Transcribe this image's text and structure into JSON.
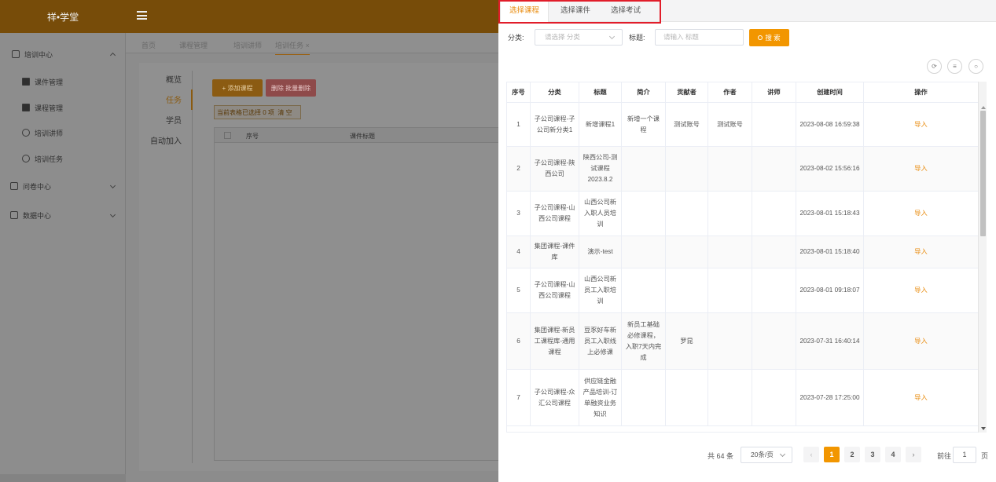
{
  "app": {
    "logo": "祥•学堂"
  },
  "sidebar": {
    "items": [
      {
        "label": "培训中心"
      },
      {
        "label": "课件管理"
      },
      {
        "label": "课程管理"
      },
      {
        "label": "培训讲师"
      },
      {
        "label": "培训任务"
      },
      {
        "label": "问卷中心"
      },
      {
        "label": "数据中心"
      }
    ]
  },
  "page_tabs": [
    {
      "label": "首页"
    },
    {
      "label": "课程管理"
    },
    {
      "label": "培训讲师"
    },
    {
      "label": "培训任务"
    }
  ],
  "page_tab_close": "×",
  "vnav": [
    {
      "label": "概览"
    },
    {
      "label": "任务"
    },
    {
      "label": "学员"
    },
    {
      "label": "自动加入"
    }
  ],
  "bg_toolbar": {
    "add": "+ 添加课程",
    "delete": "删除 批量删除",
    "selected": "当前表格已选择 0 项",
    "clear": "清 空"
  },
  "bg_table": {
    "col_index": "序号",
    "col_title": "课件标题"
  },
  "drawer": {
    "tabs": [
      {
        "label": "选择课程"
      },
      {
        "label": "选择课件"
      },
      {
        "label": "选择考试"
      }
    ],
    "filter": {
      "category_label": "分类:",
      "category_placeholder": "请选择 分类",
      "title_label": "标题:",
      "title_placeholder": "请输入 标题",
      "search_button": "搜 索"
    },
    "table": {
      "headers": [
        "序号",
        "分类",
        "标题",
        "简介",
        "贡献者",
        "作者",
        "讲师",
        "创建时间",
        "操作"
      ],
      "rows": [
        {
          "index": "1",
          "category": "子公司课程-子公司新分类1",
          "title": "新增课程1",
          "intro": "新增一个课程",
          "contributor": "测试账号",
          "author": "测试账号",
          "lecturer": "",
          "created": "2023-08-08 16:59:38",
          "op": "导入"
        },
        {
          "index": "2",
          "category": "子公司课程-陕西公司",
          "title": "陕西公司-测试课程2023.8.2",
          "intro": "",
          "contributor": "",
          "author": "",
          "lecturer": "",
          "created": "2023-08-02 15:56:16",
          "op": "导入"
        },
        {
          "index": "3",
          "category": "子公司课程-山西公司课程",
          "title": "山西公司新入职人员培训",
          "intro": "",
          "contributor": "",
          "author": "",
          "lecturer": "",
          "created": "2023-08-01 15:18:43",
          "op": "导入"
        },
        {
          "index": "4",
          "category": "集团课程-课件库",
          "title": "演示-test",
          "intro": "",
          "contributor": "",
          "author": "",
          "lecturer": "",
          "created": "2023-08-01 15:18:40",
          "op": "导入"
        },
        {
          "index": "5",
          "category": "子公司课程-山西公司课程",
          "title": "山西公司新员工入职培训",
          "intro": "",
          "contributor": "",
          "author": "",
          "lecturer": "",
          "created": "2023-08-01 09:18:07",
          "op": "导入"
        },
        {
          "index": "6",
          "category": "集团课程-新员工课程库-通用课程",
          "title": "豆豕好车新员工入职线上必修课",
          "intro": "新员工基础必修课程，入职7天内完成",
          "contributor": "罗昆",
          "author": "",
          "lecturer": "",
          "created": "2023-07-31 16:40:14",
          "op": "导入"
        },
        {
          "index": "7",
          "category": "子公司课程-众汇公司课程",
          "title": "供应链金融产品培训-订单融资业务知识",
          "intro": "",
          "contributor": "",
          "author": "",
          "lecturer": "",
          "created": "2023-07-28 17:25:00",
          "op": "导入"
        }
      ]
    },
    "pager": {
      "total": "共 64 条",
      "page_size": "20条/页",
      "pages": [
        "1",
        "2",
        "3",
        "4"
      ],
      "current": "1",
      "goto_label": "前往",
      "goto_value": "1",
      "page_suffix": "页"
    },
    "accent": "#f29600",
    "highlight": "#e11d2a"
  }
}
